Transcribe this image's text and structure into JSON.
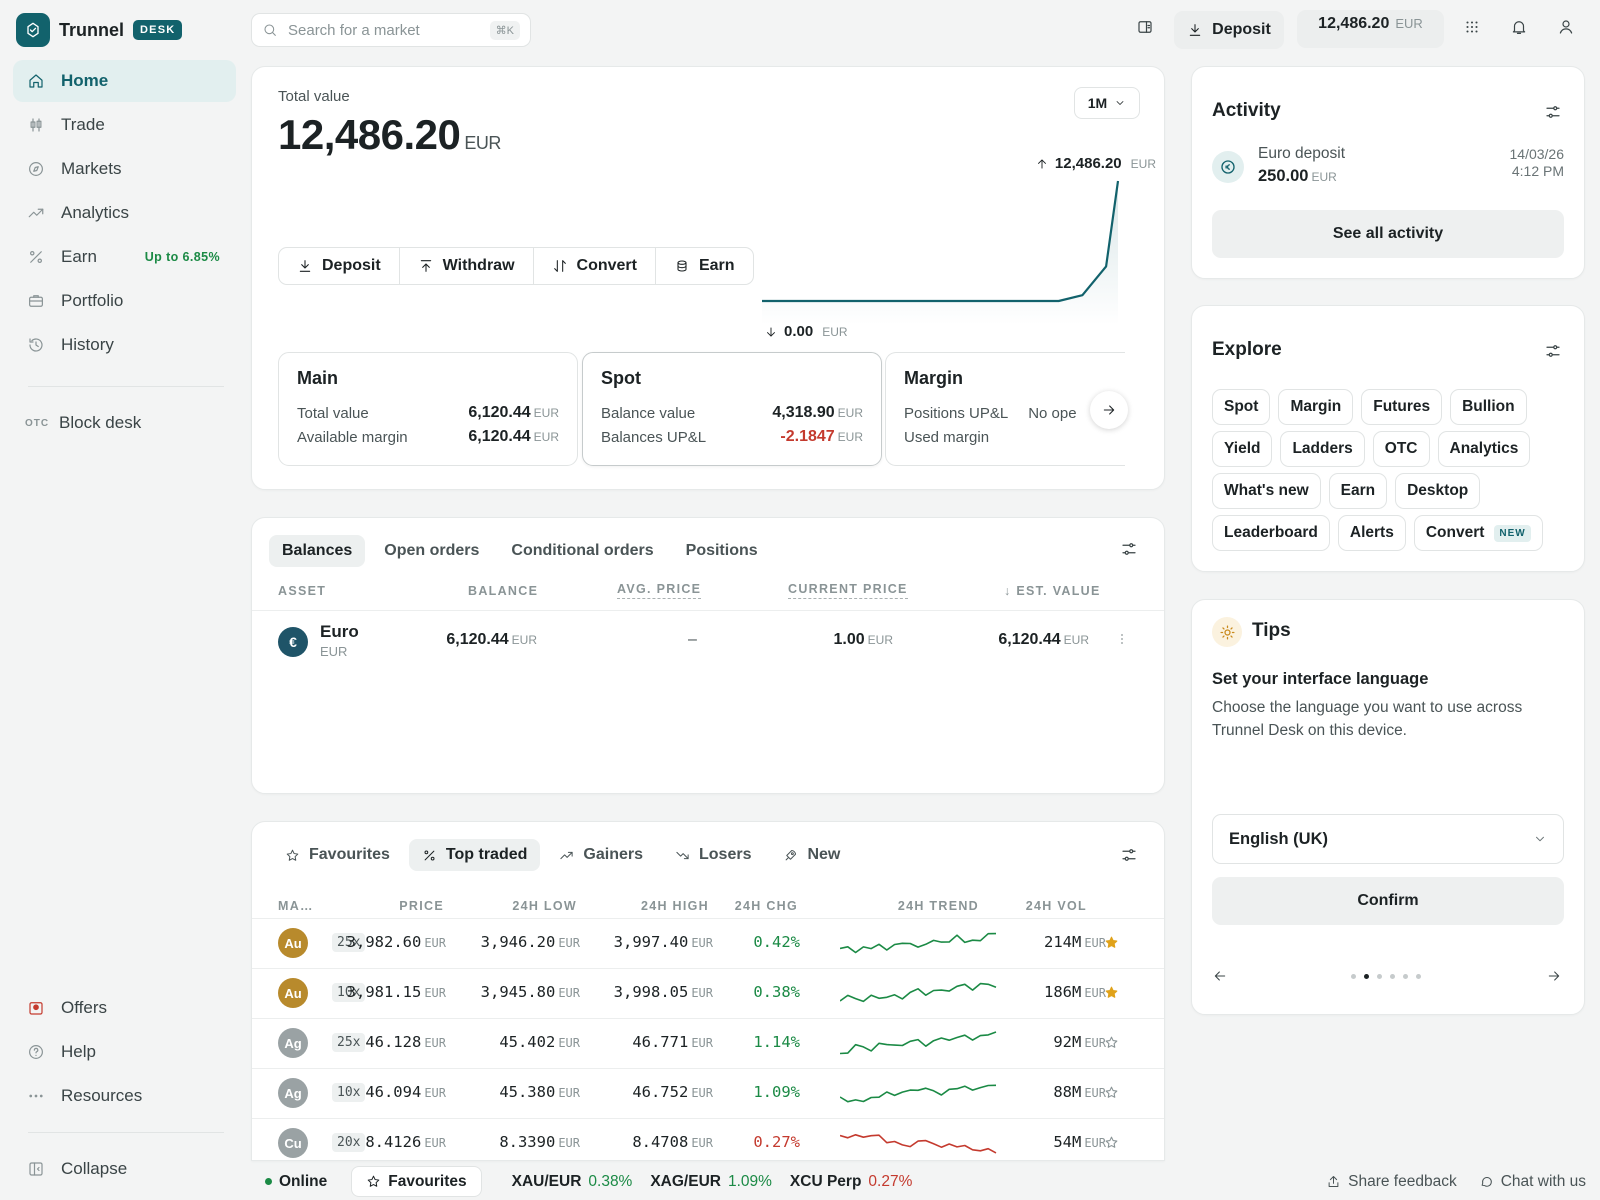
{
  "brand": {
    "name": "Trunnel",
    "badge": "DESK"
  },
  "sidebar": {
    "items": [
      {
        "label": "Home",
        "icon": "home-icon",
        "active": true
      },
      {
        "label": "Trade",
        "icon": "candles-icon"
      },
      {
        "label": "Markets",
        "icon": "compass-icon"
      },
      {
        "label": "Analytics",
        "icon": "trend-up-icon"
      },
      {
        "label": "Earn",
        "icon": "percent-icon",
        "pill": "Up to 6.85%"
      },
      {
        "label": "Portfolio",
        "icon": "briefcase-icon"
      },
      {
        "label": "History",
        "icon": "history-icon"
      }
    ],
    "otc": {
      "tag": "OTC",
      "label": "Block desk"
    },
    "bottom": [
      {
        "label": "Offers",
        "icon": "gift-icon"
      },
      {
        "label": "Help",
        "icon": "help-icon"
      },
      {
        "label": "Resources",
        "icon": "more-icon"
      }
    ],
    "collapse": "Collapse"
  },
  "topbar": {
    "search_placeholder": "Search for a market",
    "shortcut": "⌘K",
    "deposit": "Deposit",
    "balance": "12,486.20",
    "balance_unit": "EUR"
  },
  "overview": {
    "label": "Total value",
    "value": "12,486.20",
    "unit": "EUR",
    "range": "1M",
    "actions": [
      "Deposit",
      "Withdraw",
      "Convert",
      "Earn"
    ],
    "chart_high": "12,486.20",
    "chart_low": "0.00",
    "chart_unit": "EUR",
    "accounts": [
      {
        "name": "Main",
        "rows": [
          {
            "label": "Total value",
            "value": "6,120.44",
            "unit": "EUR"
          },
          {
            "label": "Available margin",
            "value": "6,120.44",
            "unit": "EUR"
          }
        ]
      },
      {
        "name": "Spot",
        "rows": [
          {
            "label": "Balance value",
            "value": "4,318.90",
            "unit": "EUR"
          },
          {
            "label": "Balances UP&L",
            "value": "-2.1847",
            "unit": "EUR"
          }
        ]
      },
      {
        "name": "Margin",
        "rows": [
          {
            "label": "Positions UP&L",
            "value": "No ope"
          },
          {
            "label": "Used margin",
            "value": ""
          }
        ]
      }
    ]
  },
  "chart_data": {
    "type": "area",
    "x": [
      0,
      5,
      10,
      15,
      20,
      25,
      27,
      29,
      30
    ],
    "values": [
      0,
      0,
      0,
      0,
      0,
      0,
      600,
      3600,
      12486.2
    ],
    "ylim": [
      0,
      12486.2
    ]
  },
  "balances": {
    "tabs": [
      "Balances",
      "Open orders",
      "Conditional orders",
      "Positions"
    ],
    "columns": [
      "ASSET",
      "BALANCE",
      "AVG. PRICE",
      "CURRENT PRICE",
      "EST. VALUE"
    ],
    "rows": [
      {
        "coin": "€",
        "name": "Euro",
        "code": "EUR",
        "balance": "6,120.44",
        "avg": "–",
        "current": "1.00",
        "est": "6,120.44",
        "unit": "EUR"
      }
    ]
  },
  "markets": {
    "tabs": [
      "Favourites",
      "Top traded",
      "Gainers",
      "Losers",
      "New"
    ],
    "columns": [
      "MA…",
      "PRICE",
      "24H LOW",
      "24H HIGH",
      "24H CHG",
      "24H TREND",
      "24H VOL"
    ],
    "unit": "EUR",
    "rows": [
      {
        "coin": "Au",
        "color": "#b88a2c",
        "lev": "25x",
        "price": "3,982.60",
        "low": "3,946.20",
        "high": "3,997.40",
        "chg": "0.42%",
        "dir": "up",
        "vol": "214M",
        "fav": true
      },
      {
        "coin": "Au",
        "color": "#b88a2c",
        "lev": "10x",
        "price": "3,981.15",
        "low": "3,945.80",
        "high": "3,998.05",
        "chg": "0.38%",
        "dir": "up",
        "vol": "186M",
        "fav": true
      },
      {
        "coin": "Ag",
        "color": "#9aa2a4",
        "lev": "25x",
        "price": "46.128",
        "low": "45.402",
        "high": "46.771",
        "chg": "1.14%",
        "dir": "up",
        "vol": "92M",
        "fav": false
      },
      {
        "coin": "Ag",
        "color": "#9aa2a4",
        "lev": "10x",
        "price": "46.094",
        "low": "45.380",
        "high": "46.752",
        "chg": "1.09%",
        "dir": "up",
        "vol": "88M",
        "fav": false
      },
      {
        "coin": "Cu",
        "color": "#9aa2a4",
        "lev": "20x",
        "price": "8.4126",
        "low": "8.3390",
        "high": "8.4708",
        "chg": "0.27%",
        "dir": "down",
        "vol": "54M",
        "fav": false
      }
    ]
  },
  "activity": {
    "title": "Activity",
    "item": {
      "label": "Euro deposit",
      "amount": "250.00",
      "unit": "EUR",
      "date": "14/03/26",
      "time": "4:12 PM"
    },
    "see_all": "See all activity"
  },
  "explore": {
    "title": "Explore",
    "chips": [
      "Spot",
      "Margin",
      "Futures",
      "Bullion",
      "Yield",
      "Ladders",
      "OTC",
      "Analytics",
      "What's new",
      "Earn",
      "Desktop",
      "Leaderboard",
      "Alerts",
      "Convert"
    ],
    "new_badge": "NEW"
  },
  "tips": {
    "title": "Tips",
    "heading": "Set your interface language",
    "body": "Choose the language you want to use across Trunnel Desk on this device.",
    "select": "English (UK)",
    "confirm": "Confirm",
    "page": 2,
    "pages": 6
  },
  "status": {
    "online": "Online",
    "favourites": "Favourites",
    "tickers": [
      {
        "pair": "XAU/EUR",
        "chg": "0.38%",
        "dir": "up"
      },
      {
        "pair": "XAG/EUR",
        "chg": "1.09%",
        "dir": "up"
      },
      {
        "pair": "XCU Perp",
        "chg": "0.27%",
        "dir": "down"
      }
    ],
    "feedback": "Share feedback",
    "chat": "Chat with us"
  },
  "colors": {
    "accent": "#12626c",
    "positive": "#1b8a45",
    "negative": "#c43a2e"
  }
}
